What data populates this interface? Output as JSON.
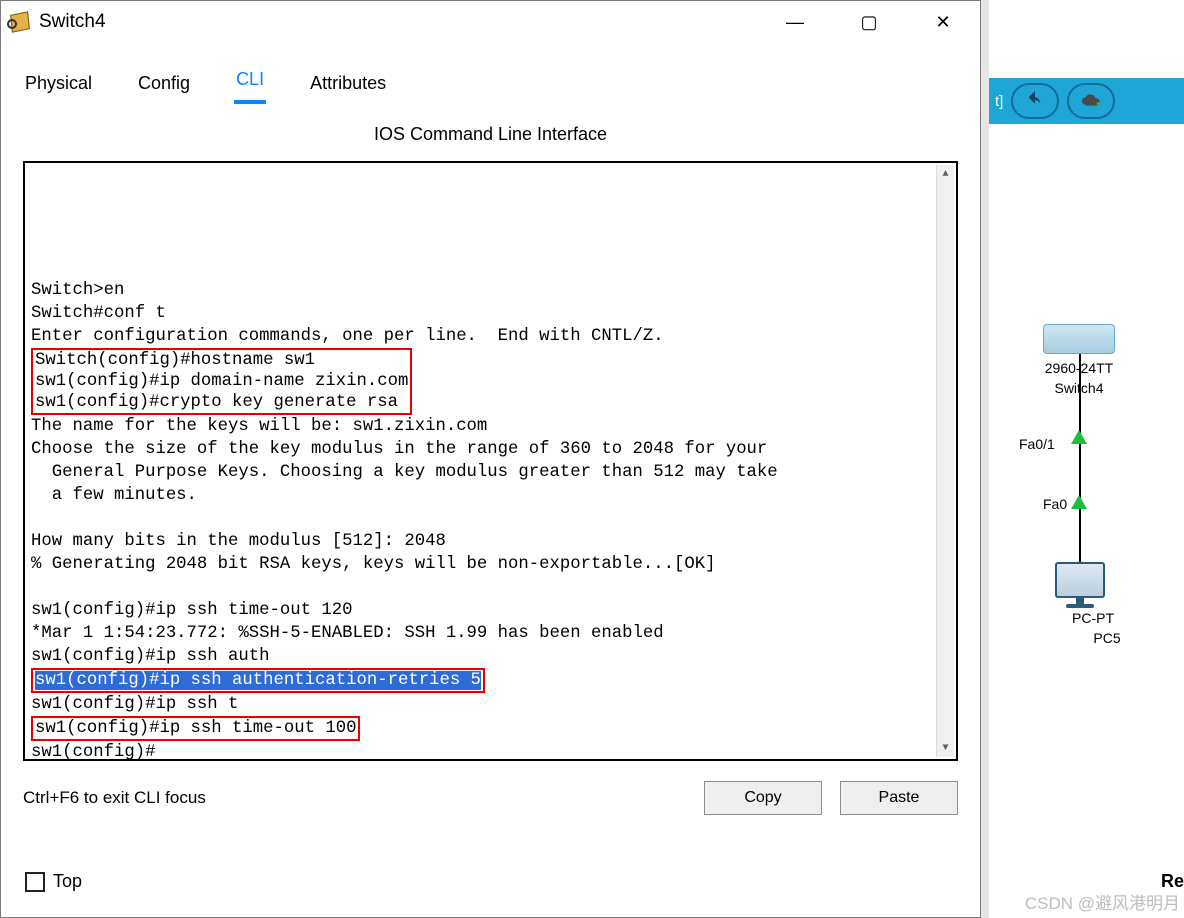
{
  "window": {
    "title": "Switch4",
    "controls": {
      "min": "—",
      "max": "▢",
      "close": "✕"
    }
  },
  "tabs": {
    "items": [
      "Physical",
      "Config",
      "CLI",
      "Attributes"
    ],
    "active_index": 2
  },
  "pane_title": "IOS Command Line Interface",
  "terminal": {
    "lines": [
      "Switch>en",
      "Switch#conf t",
      "Enter configuration commands, one per line.  End with CNTL/Z.",
      "Switch(config)#hostname sw1",
      "sw1(config)#ip domain-name zixin.com",
      "sw1(config)#crypto key generate rsa",
      "The name for the keys will be: sw1.zixin.com",
      "Choose the size of the key modulus in the range of 360 to 2048 for your",
      "  General Purpose Keys. Choosing a key modulus greater than 512 may take",
      "  a few minutes.",
      "",
      "How many bits in the modulus [512]: 2048",
      "% Generating 2048 bit RSA keys, keys will be non-exportable...[OK]",
      "",
      "sw1(config)#ip ssh time-out 120",
      "*Mar 1 1:54:23.772: %SSH-5-ENABLED: SSH 1.99 has been enabled",
      "sw1(config)#ip ssh auth",
      "sw1(config)#ip ssh authentication-retries 5",
      "sw1(config)#ip ssh t",
      "sw1(config)#ip ssh time-out 100",
      "sw1(config)#"
    ],
    "red_box_group1_start": 3,
    "red_box_group1_end": 5,
    "blue_selected_line": 17,
    "red_box_line_solo": 19
  },
  "hint": "Ctrl+F6 to exit CLI focus",
  "buttons": {
    "copy": "Copy",
    "paste": "Paste"
  },
  "bottom_checkbox_label": "Top",
  "toolbar": {
    "left_text": "t]"
  },
  "topology": {
    "switch_model": "2960-24TT",
    "switch_name": "Switch4",
    "port_top": "Fa0/1",
    "port_bottom": "Fa0",
    "pc_model": "PC-PT",
    "pc_name": "PC5"
  },
  "watermark": "CSDN @避风港明月",
  "fragment": "Re"
}
